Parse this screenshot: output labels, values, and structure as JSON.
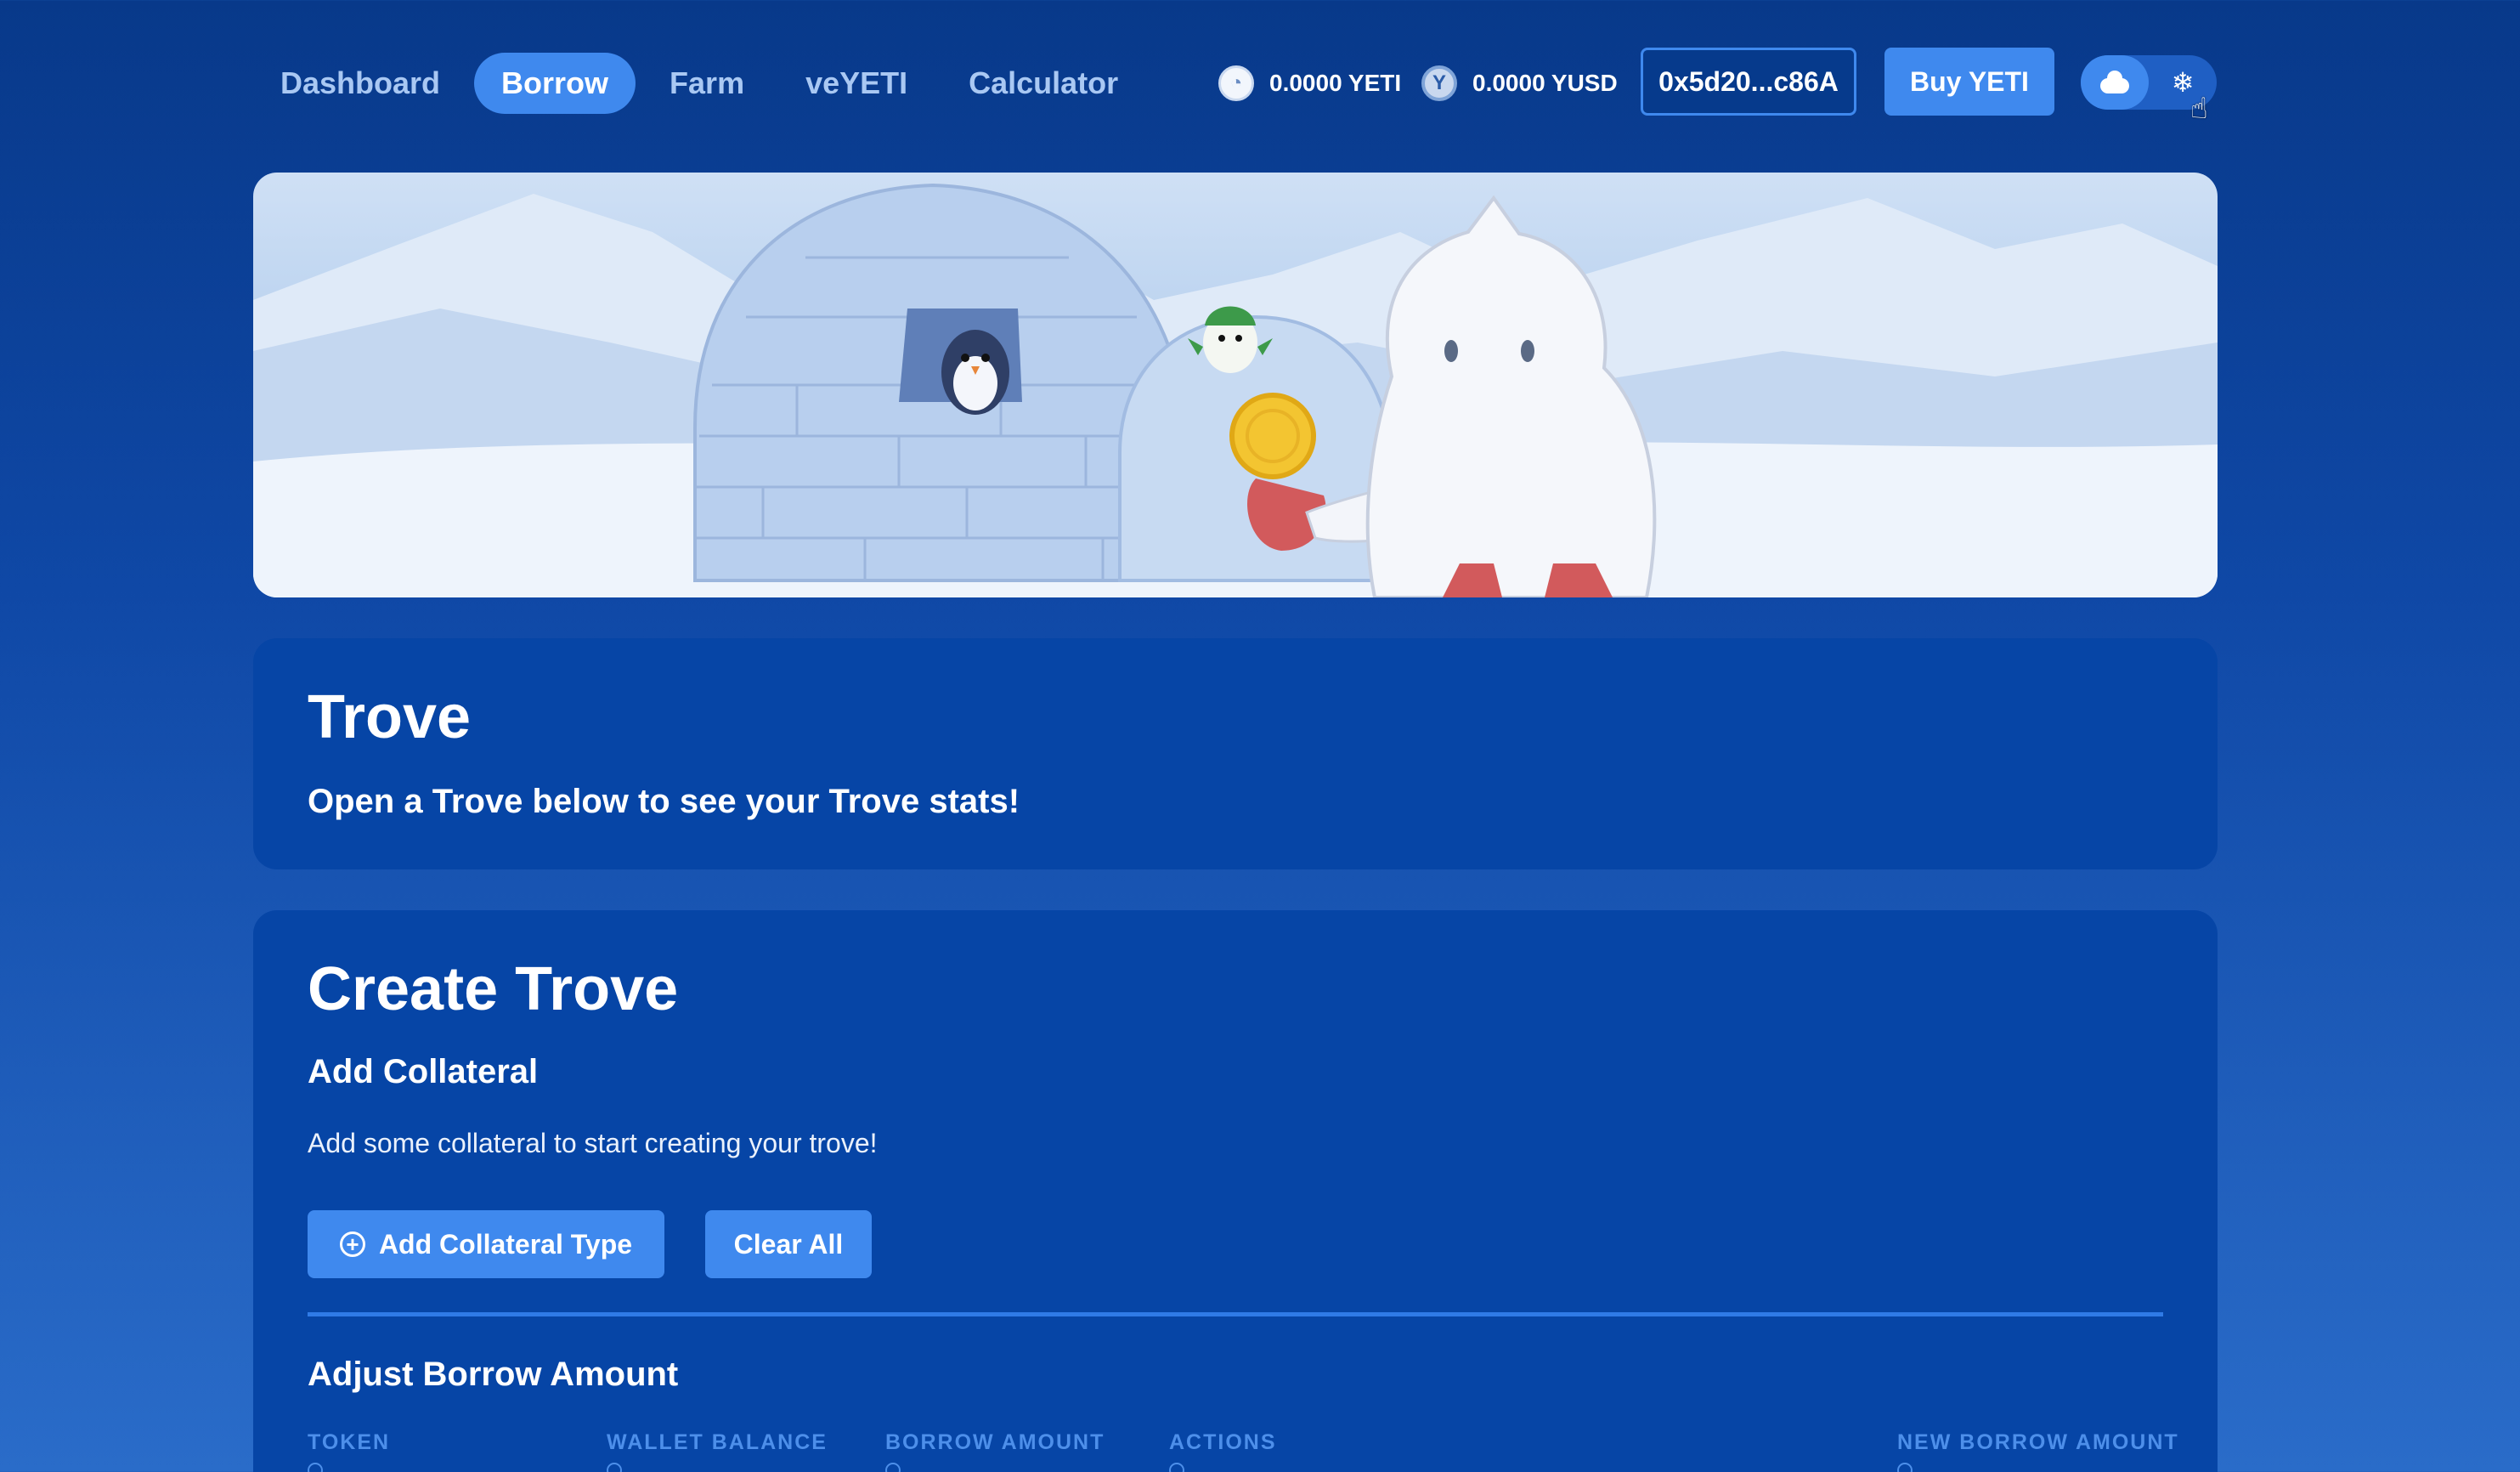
{
  "nav": {
    "links": [
      {
        "label": "Dashboard",
        "active": false
      },
      {
        "label": "Borrow",
        "active": true
      },
      {
        "label": "Farm",
        "active": false
      },
      {
        "label": "veYETI",
        "active": false
      },
      {
        "label": "Calculator",
        "active": false
      }
    ],
    "balances": {
      "yeti": {
        "amount": "0.0000 YETI",
        "icon": "yeti-coin-icon"
      },
      "yusd": {
        "amount": "0.0000 YUSD",
        "icon": "yusd-coin-icon",
        "glyph": "Y"
      }
    },
    "wallet_address": "0x5d20...c86A",
    "buy_label": "Buy YETI",
    "theme_toggle": {
      "options": [
        "cloud-icon",
        "snowflake-icon"
      ],
      "snow_glyph": "❄"
    }
  },
  "trove": {
    "title": "Trove",
    "subtitle": "Open a Trove below to see your Trove stats!"
  },
  "create": {
    "title": "Create Trove",
    "add_collateral_title": "Add Collateral",
    "hint": "Add some collateral to start creating your trove!",
    "add_collateral_button": "Add Collateral Type",
    "clear_button": "Clear All",
    "borrow_title": "Adjust Borrow Amount",
    "columns": [
      "TOKEN",
      "WALLET BALANCE",
      "BORROW AMOUNT",
      "ACTIONS",
      "NEW BORROW AMOUNT"
    ]
  },
  "colors": {
    "background": "#0b409a",
    "card": "#0645a6",
    "accent": "#3f89ee",
    "column_header": "#4d8fea"
  }
}
